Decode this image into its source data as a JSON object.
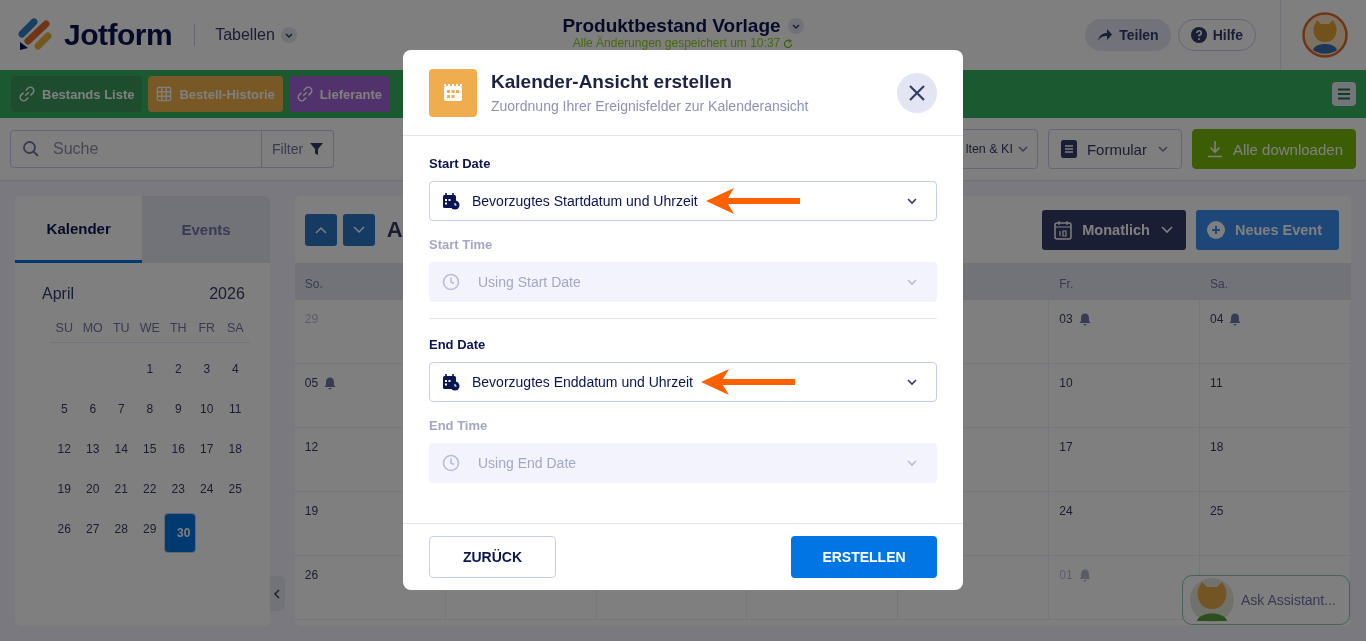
{
  "header": {
    "logo_text": "Jotform",
    "section": "Tabellen",
    "title": "Produktbestand Vorlage",
    "save_status": "Alle Änderungen gespeichert um 10:37",
    "buttons": [
      {
        "label": "Teilen",
        "kind": "share"
      },
      {
        "label": "Hilfe",
        "kind": "help"
      }
    ]
  },
  "table_tabs": [
    {
      "label": "Bestands Liste"
    },
    {
      "label": "Bestell-Historie"
    },
    {
      "label": "Lieferante"
    }
  ],
  "toolbar": {
    "search": {
      "placeholder": "Suche"
    },
    "filter": "Filter",
    "buttons": [
      {
        "label": "lten & KI",
        "kind": "dropdown"
      },
      {
        "label": "Formular",
        "kind": "form"
      },
      {
        "label": "Alle downloaden",
        "kind": "download"
      }
    ]
  },
  "sidebar": {
    "tabs": [
      {
        "label": "Kalender",
        "selected": true
      },
      {
        "label": "Events",
        "selected": false
      }
    ],
    "month": "April",
    "year": "2026",
    "weekdays": [
      "SU",
      "MO",
      "TU",
      "WE",
      "TH",
      "FR",
      "SA"
    ],
    "weeks": [
      [
        {
          "day": "1",
          "selected": false
        },
        {
          "day": "2",
          "selected": false
        },
        {
          "day": "3",
          "selected": false
        },
        {
          "day": "4",
          "selected": false
        }
      ],
      [
        {
          "day": "5",
          "selected": false
        },
        {
          "day": "6",
          "selected": false
        },
        {
          "day": "7",
          "selected": false
        },
        {
          "day": "8",
          "selected": false
        },
        {
          "day": "9",
          "selected": false
        },
        {
          "day": "10",
          "selected": false
        },
        {
          "day": "11",
          "selected": false
        }
      ],
      [
        {
          "day": "12",
          "selected": false
        },
        {
          "day": "13",
          "selected": false
        },
        {
          "day": "14",
          "selected": false
        },
        {
          "day": "15",
          "selected": false
        },
        {
          "day": "16",
          "selected": false
        },
        {
          "day": "17",
          "selected": false
        },
        {
          "day": "18",
          "selected": false
        }
      ],
      [
        {
          "day": "19",
          "selected": false
        },
        {
          "day": "20",
          "selected": false
        },
        {
          "day": "21",
          "selected": false
        },
        {
          "day": "22",
          "selected": false
        },
        {
          "day": "23",
          "selected": false
        },
        {
          "day": "24",
          "selected": false
        },
        {
          "day": "25",
          "selected": false
        }
      ],
      [
        {
          "day": "26",
          "selected": false
        },
        {
          "day": "27",
          "selected": false
        },
        {
          "day": "28",
          "selected": false
        },
        {
          "day": "29",
          "selected": false
        },
        {
          "day": "30",
          "selected": true
        }
      ]
    ]
  },
  "calendar": {
    "month_title": "A",
    "view": "Monatlich",
    "new_event": "Neues Event",
    "columns": [
      {
        "weekday": "So.",
        "days": [
          {
            "date": "29",
            "muted": true,
            "bell": false
          },
          {
            "date": "05",
            "muted": false,
            "bell": true
          },
          {
            "date": "12",
            "muted": false,
            "bell": false
          },
          {
            "date": "19",
            "muted": false,
            "bell": false
          },
          {
            "date": "26",
            "muted": false,
            "bell": false
          }
        ]
      },
      {
        "weekday": "Fr.",
        "days": [
          {
            "date": "03",
            "muted": false,
            "bell": true
          },
          {
            "date": "10",
            "muted": false,
            "bell": false
          },
          {
            "date": "17",
            "muted": false,
            "bell": false
          },
          {
            "date": "24",
            "muted": false,
            "bell": false
          },
          {
            "date": "01",
            "muted": true,
            "bell": true
          }
        ]
      },
      {
        "weekday": "Sa.",
        "days": [
          {
            "date": "04",
            "muted": false,
            "bell": true
          },
          {
            "date": "11",
            "muted": false,
            "bell": false
          },
          {
            "date": "18",
            "muted": false,
            "bell": false
          },
          {
            "date": "25",
            "muted": false,
            "bell": false
          }
        ]
      }
    ]
  },
  "assistant": {
    "label": "Ask Assistant..."
  },
  "dialog": {
    "title": "Kalender-Ansicht erstellen",
    "subtitle": "Zuordnung Ihrer Ereignisfelder zur Kalenderansicht",
    "groups": [
      {
        "fields": [
          {
            "label": "Start Date",
            "kind": "date",
            "value": "Bevorzugtes Startdatum und Uhrzeit",
            "disabled": false,
            "arrow": true
          },
          {
            "label": "Start Time",
            "kind": "time",
            "placeholder": "Using Start Date",
            "disabled": true,
            "arrow": false
          }
        ]
      },
      {
        "fields": [
          {
            "label": "End Date",
            "kind": "date",
            "value": "Bevorzugtes Enddatum und Uhrzeit",
            "disabled": false,
            "arrow": true
          },
          {
            "label": "End Time",
            "kind": "time",
            "placeholder": "Using End Date",
            "disabled": true,
            "arrow": false
          }
        ]
      }
    ],
    "back": "ZURÜCK",
    "submit": "ERSTELLEN"
  }
}
